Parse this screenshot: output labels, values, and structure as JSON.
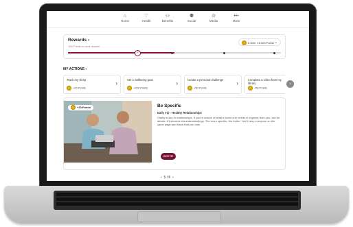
{
  "nav": {
    "items": [
      {
        "label": "Home",
        "icon": "home-icon"
      },
      {
        "label": "Health",
        "icon": "heart-icon"
      },
      {
        "label": "Benefits",
        "icon": "benefits-icon"
      },
      {
        "label": "Social",
        "icon": "people-icon"
      },
      {
        "label": "Media",
        "icon": "media-icon"
      },
      {
        "label": "More",
        "icon": "more-icon"
      }
    ]
  },
  "rewards": {
    "title": "Rewards",
    "subtitle": "125 Points to next reward!",
    "points": "6,000 / 15,000 Points",
    "progress": 0.5
  },
  "actions": {
    "title": "MY ACTIONS",
    "cards": [
      {
        "title": "Track my sleep",
        "points": "+20 Points"
      },
      {
        "title": "Set a wellbeing goal",
        "points": "+200 Points"
      },
      {
        "title": "Create a personal challenge",
        "points": "+50 Points"
      },
      {
        "title": "Complete a video from my library",
        "points": "+50 Points"
      }
    ]
  },
  "feature": {
    "badge": "+20 Points",
    "title": "Be Specific",
    "subtitle": "Daily Tip - Healthy Relationships",
    "body": "Clarity is key in relationships. If you're unsure of what a loved one needs or expects from you, ask for details. It'll prevent misunderstandings. The more specific, the better. You'll keep everyone on the same page and show that you care.",
    "button": "GOT IT!"
  },
  "pager": {
    "text": "5 / 8"
  },
  "colors": {
    "accent": "#8c1240",
    "button": "#7a1338",
    "coin": "#e2b013"
  }
}
